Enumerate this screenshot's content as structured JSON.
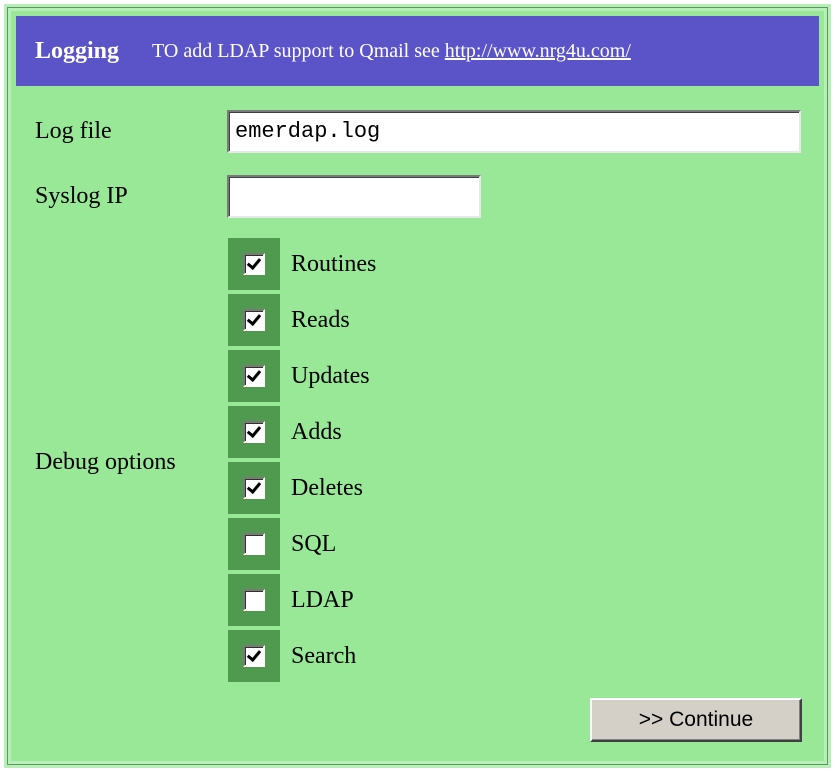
{
  "header": {
    "title": "Logging",
    "note": "TO add LDAP support to Qmail see ",
    "link": "http://www.nrg4u.com/"
  },
  "fields": {
    "log_file": {
      "label": "Log file",
      "value": "emerdap.log"
    },
    "syslog_ip": {
      "label": "Syslog IP",
      "value": ""
    }
  },
  "debug": {
    "label": "Debug options",
    "options": [
      {
        "label": "Routines",
        "checked": true
      },
      {
        "label": "Reads",
        "checked": true
      },
      {
        "label": "Updates",
        "checked": true
      },
      {
        "label": "Adds",
        "checked": true
      },
      {
        "label": "Deletes",
        "checked": true
      },
      {
        "label": "SQL",
        "checked": false
      },
      {
        "label": "LDAP",
        "checked": false
      },
      {
        "label": "Search",
        "checked": true
      }
    ]
  },
  "continue_label": ">> Continue",
  "colors": {
    "panel_bg": "#98e898",
    "header_bg": "#5b54c8",
    "checkbox_cell": "#4f9a4f",
    "button_bg": "#d4d0c8"
  }
}
